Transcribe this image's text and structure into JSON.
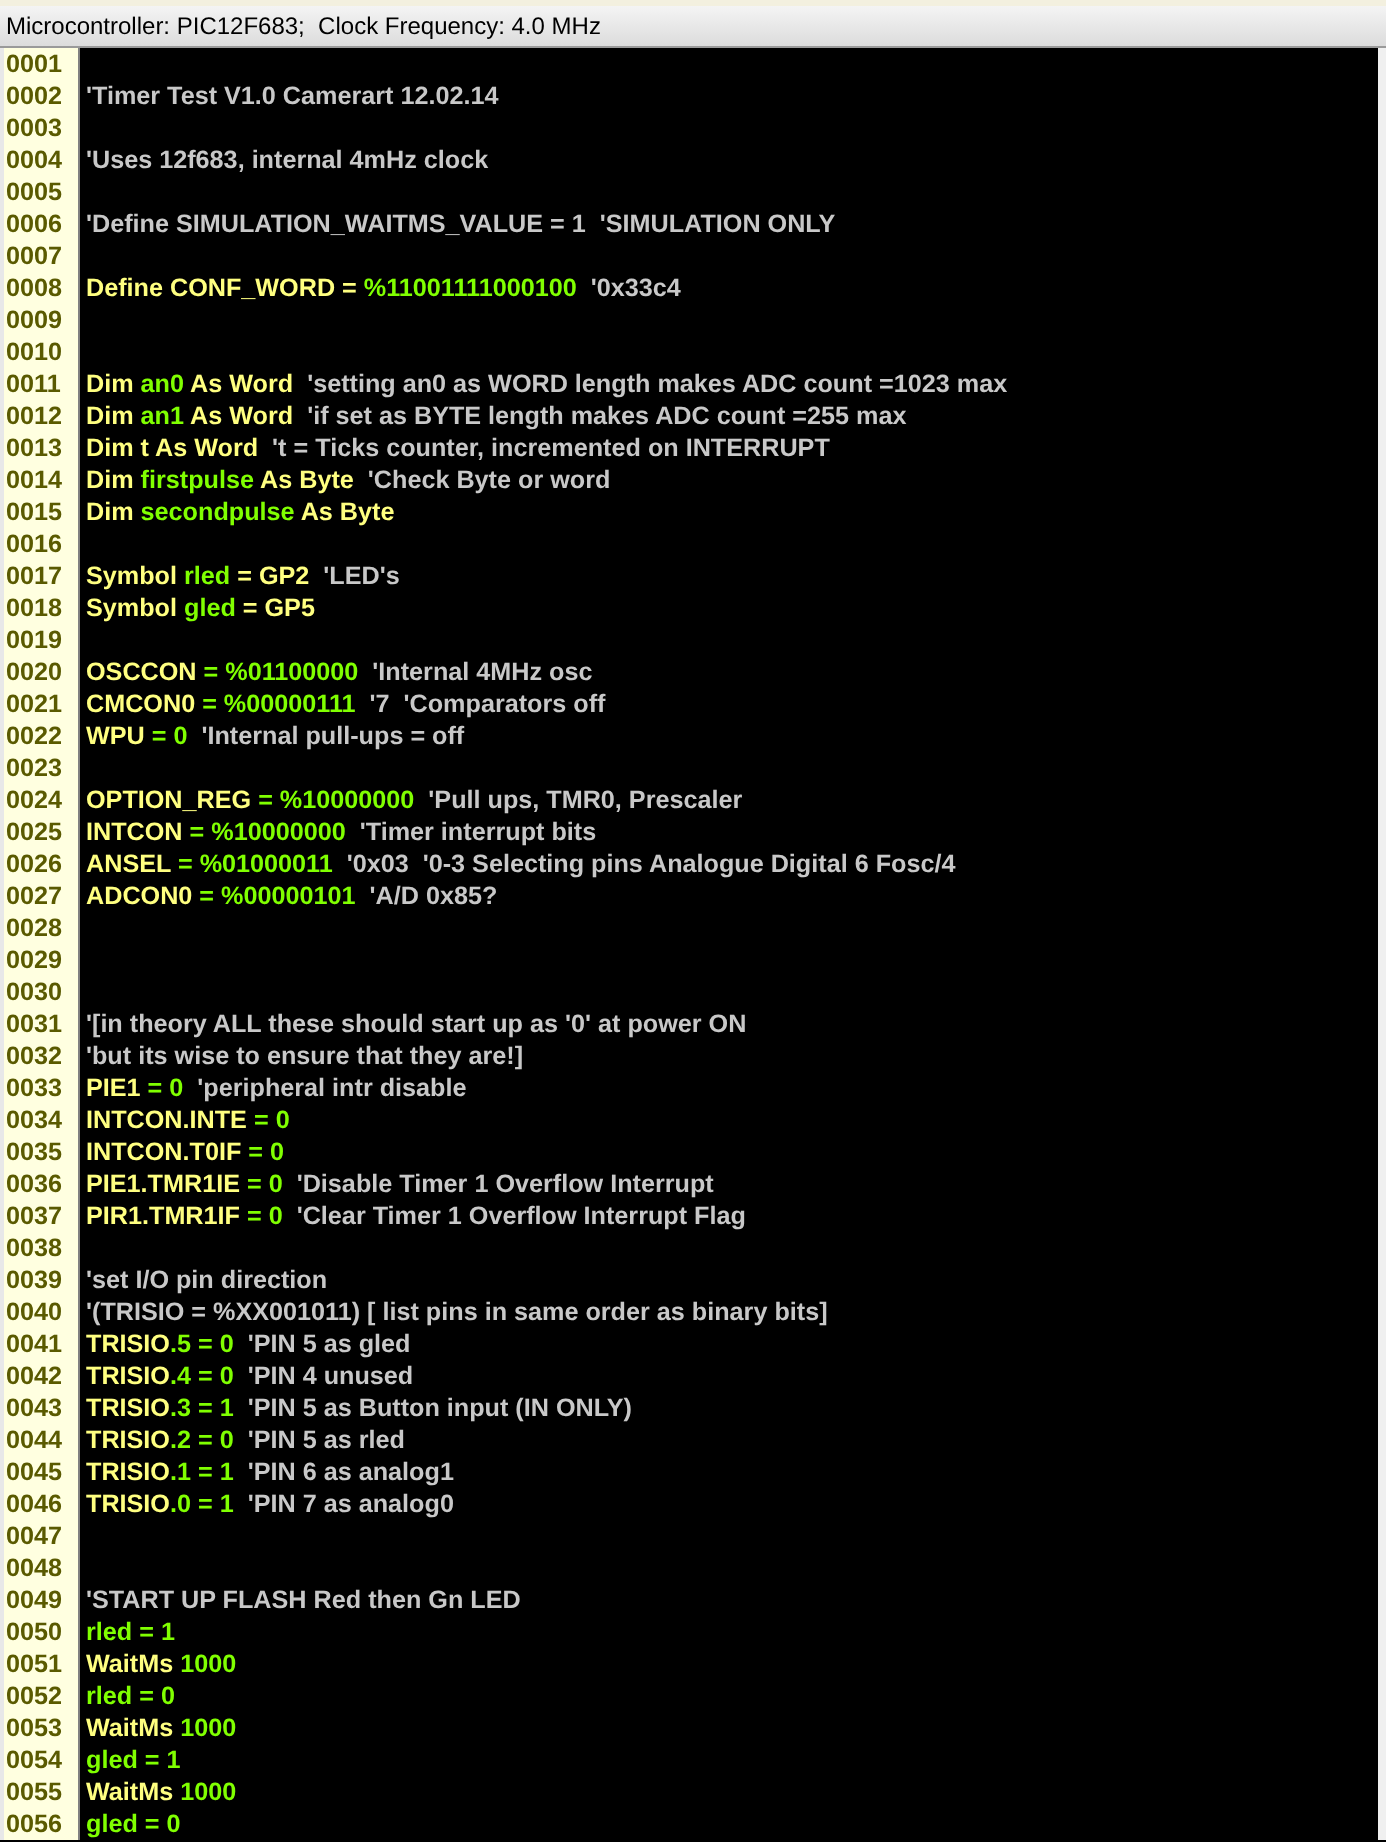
{
  "status_bar": {
    "text": "Microcontroller: PIC12F683;  Clock Frequency: 4.0 MHz"
  },
  "editor": {
    "lines": [
      {
        "number": "0001"
      },
      {
        "number": "0002",
        "tokens": [
          {
            "kind": "comment",
            "text": "'Timer Test V1.0 Camerart 12.02.14"
          }
        ]
      },
      {
        "number": "0003"
      },
      {
        "number": "0004",
        "tokens": [
          {
            "kind": "comment",
            "text": "'Uses 12f683, internal 4mHz clock"
          }
        ]
      },
      {
        "number": "0005"
      },
      {
        "number": "0006",
        "tokens": [
          {
            "kind": "comment",
            "text": "'Define SIMULATION_WAITMS_VALUE = 1  'SIMULATION ONLY"
          }
        ]
      },
      {
        "number": "0007"
      },
      {
        "number": "0008",
        "tokens": [
          {
            "kind": "keyword",
            "text": "Define CONF_WORD = "
          },
          {
            "kind": "name",
            "text": "%11001111000100"
          },
          {
            "kind": "comment",
            "text": "  '0x33c4"
          }
        ]
      },
      {
        "number": "0009"
      },
      {
        "number": "0010"
      },
      {
        "number": "0011",
        "tokens": [
          {
            "kind": "keyword",
            "text": "Dim "
          },
          {
            "kind": "name",
            "text": "an0"
          },
          {
            "kind": "keyword",
            "text": " As Word"
          },
          {
            "kind": "comment",
            "text": "  'setting an0 as WORD length makes ADC count =1023 max"
          }
        ]
      },
      {
        "number": "0012",
        "tokens": [
          {
            "kind": "keyword",
            "text": "Dim "
          },
          {
            "kind": "name",
            "text": "an1"
          },
          {
            "kind": "keyword",
            "text": " As Word"
          },
          {
            "kind": "comment",
            "text": "  'if set as BYTE length makes ADC count =255 max"
          }
        ]
      },
      {
        "number": "0013",
        "tokens": [
          {
            "kind": "keyword",
            "text": "Dim t As Word"
          },
          {
            "kind": "comment",
            "text": "  't = Ticks counter, incremented on INTERRUPT"
          }
        ]
      },
      {
        "number": "0014",
        "tokens": [
          {
            "kind": "keyword",
            "text": "Dim "
          },
          {
            "kind": "name",
            "text": "firstpulse"
          },
          {
            "kind": "keyword",
            "text": " As Byte"
          },
          {
            "kind": "comment",
            "text": "  'Check Byte or word"
          }
        ]
      },
      {
        "number": "0015",
        "tokens": [
          {
            "kind": "keyword",
            "text": "Dim "
          },
          {
            "kind": "name",
            "text": "secondpulse"
          },
          {
            "kind": "keyword",
            "text": " As Byte"
          }
        ]
      },
      {
        "number": "0016"
      },
      {
        "number": "0017",
        "tokens": [
          {
            "kind": "keyword",
            "text": "Symbol "
          },
          {
            "kind": "name",
            "text": "rled"
          },
          {
            "kind": "keyword",
            "text": " = GP2"
          },
          {
            "kind": "comment",
            "text": "  'LED's"
          }
        ]
      },
      {
        "number": "0018",
        "tokens": [
          {
            "kind": "keyword",
            "text": "Symbol "
          },
          {
            "kind": "name",
            "text": "gled"
          },
          {
            "kind": "keyword",
            "text": " = GP5"
          }
        ]
      },
      {
        "number": "0019"
      },
      {
        "number": "0020",
        "tokens": [
          {
            "kind": "keyword",
            "text": "OSCCON"
          },
          {
            "kind": "name",
            "text": " = %01100000"
          },
          {
            "kind": "comment",
            "text": "  'Internal 4MHz osc"
          }
        ]
      },
      {
        "number": "0021",
        "tokens": [
          {
            "kind": "keyword",
            "text": "CMCON0"
          },
          {
            "kind": "name",
            "text": " = %00000111"
          },
          {
            "kind": "comment",
            "text": "  '7  'Comparators off"
          }
        ]
      },
      {
        "number": "0022",
        "tokens": [
          {
            "kind": "keyword",
            "text": "WPU"
          },
          {
            "kind": "name",
            "text": " = 0"
          },
          {
            "kind": "comment",
            "text": "  'Internal pull-ups = off"
          }
        ]
      },
      {
        "number": "0023"
      },
      {
        "number": "0024",
        "tokens": [
          {
            "kind": "keyword",
            "text": "OPTION_REG"
          },
          {
            "kind": "name",
            "text": " = %10000000"
          },
          {
            "kind": "comment",
            "text": "  'Pull ups, TMR0, Prescaler"
          }
        ]
      },
      {
        "number": "0025",
        "tokens": [
          {
            "kind": "keyword",
            "text": "INTCON"
          },
          {
            "kind": "name",
            "text": " = %10000000"
          },
          {
            "kind": "comment",
            "text": "  'Timer interrupt bits"
          }
        ]
      },
      {
        "number": "0026",
        "tokens": [
          {
            "kind": "keyword",
            "text": "ANSEL"
          },
          {
            "kind": "name",
            "text": " = %01000011"
          },
          {
            "kind": "comment",
            "text": "  '0x03  '0-3 Selecting pins Analogue Digital 6 Fosc/4"
          }
        ]
      },
      {
        "number": "0027",
        "tokens": [
          {
            "kind": "keyword",
            "text": "ADCON0"
          },
          {
            "kind": "name",
            "text": " = %00000101"
          },
          {
            "kind": "comment",
            "text": "  'A/D 0x85?"
          }
        ]
      },
      {
        "number": "0028"
      },
      {
        "number": "0029"
      },
      {
        "number": "0030"
      },
      {
        "number": "0031",
        "tokens": [
          {
            "kind": "comment",
            "text": "'[in theory ALL these should start up as '0' at power ON"
          }
        ]
      },
      {
        "number": "0032",
        "tokens": [
          {
            "kind": "comment",
            "text": "'but its wise to ensure that they are!]"
          }
        ]
      },
      {
        "number": "0033",
        "tokens": [
          {
            "kind": "keyword",
            "text": "PIE1"
          },
          {
            "kind": "name",
            "text": " = 0"
          },
          {
            "kind": "comment",
            "text": "  'peripheral intr disable"
          }
        ]
      },
      {
        "number": "0034",
        "tokens": [
          {
            "kind": "keyword",
            "text": "INTCON.INTE"
          },
          {
            "kind": "name",
            "text": " = 0"
          }
        ]
      },
      {
        "number": "0035",
        "tokens": [
          {
            "kind": "keyword",
            "text": "INTCON.T0IF"
          },
          {
            "kind": "name",
            "text": " = 0"
          }
        ]
      },
      {
        "number": "0036",
        "tokens": [
          {
            "kind": "keyword",
            "text": "PIE1.TMR1IE"
          },
          {
            "kind": "name",
            "text": " = 0"
          },
          {
            "kind": "comment",
            "text": "  'Disable Timer 1 Overflow Interrupt"
          }
        ]
      },
      {
        "number": "0037",
        "tokens": [
          {
            "kind": "keyword",
            "text": "PIR1.TMR1IF"
          },
          {
            "kind": "name",
            "text": " = 0"
          },
          {
            "kind": "comment",
            "text": "  'Clear Timer 1 Overflow Interrupt Flag"
          }
        ]
      },
      {
        "number": "0038"
      },
      {
        "number": "0039",
        "tokens": [
          {
            "kind": "comment",
            "text": "'set I/O pin direction"
          }
        ]
      },
      {
        "number": "0040",
        "tokens": [
          {
            "kind": "comment",
            "text": "'(TRISIO = %XX001011) [ list pins in same order as binary bits]"
          }
        ]
      },
      {
        "number": "0041",
        "tokens": [
          {
            "kind": "keyword",
            "text": "TRISIO"
          },
          {
            "kind": "name",
            "text": ".5 = 0"
          },
          {
            "kind": "comment",
            "text": "  'PIN 5 as gled"
          }
        ]
      },
      {
        "number": "0042",
        "tokens": [
          {
            "kind": "keyword",
            "text": "TRISIO"
          },
          {
            "kind": "name",
            "text": ".4 = 0"
          },
          {
            "kind": "comment",
            "text": "  'PIN 4 unused"
          }
        ]
      },
      {
        "number": "0043",
        "tokens": [
          {
            "kind": "keyword",
            "text": "TRISIO"
          },
          {
            "kind": "name",
            "text": ".3 = 1"
          },
          {
            "kind": "comment",
            "text": "  'PIN 5 as Button input (IN ONLY)"
          }
        ]
      },
      {
        "number": "0044",
        "tokens": [
          {
            "kind": "keyword",
            "text": "TRISIO"
          },
          {
            "kind": "name",
            "text": ".2 = 0"
          },
          {
            "kind": "comment",
            "text": "  'PIN 5 as rled"
          }
        ]
      },
      {
        "number": "0045",
        "tokens": [
          {
            "kind": "keyword",
            "text": "TRISIO"
          },
          {
            "kind": "name",
            "text": ".1 = 1"
          },
          {
            "kind": "comment",
            "text": "  'PIN 6 as analog1"
          }
        ]
      },
      {
        "number": "0046",
        "tokens": [
          {
            "kind": "keyword",
            "text": "TRISIO"
          },
          {
            "kind": "name",
            "text": ".0 = 1"
          },
          {
            "kind": "comment",
            "text": "  'PIN 7 as analog0"
          }
        ]
      },
      {
        "number": "0047"
      },
      {
        "number": "0048"
      },
      {
        "number": "0049",
        "tokens": [
          {
            "kind": "comment",
            "text": "'START UP FLASH Red then Gn LED"
          }
        ]
      },
      {
        "number": "0050",
        "tokens": [
          {
            "kind": "name",
            "text": "rled = 1"
          }
        ]
      },
      {
        "number": "0051",
        "tokens": [
          {
            "kind": "keyword",
            "text": "WaitMs "
          },
          {
            "kind": "name",
            "text": "1000"
          }
        ]
      },
      {
        "number": "0052",
        "tokens": [
          {
            "kind": "name",
            "text": "rled = 0"
          }
        ]
      },
      {
        "number": "0053",
        "tokens": [
          {
            "kind": "keyword",
            "text": "WaitMs "
          },
          {
            "kind": "name",
            "text": "1000"
          }
        ]
      },
      {
        "number": "0054",
        "tokens": [
          {
            "kind": "name",
            "text": "gled = 1"
          }
        ]
      },
      {
        "number": "0055",
        "tokens": [
          {
            "kind": "keyword",
            "text": "WaitMs "
          },
          {
            "kind": "name",
            "text": "1000"
          }
        ]
      },
      {
        "number": "0056",
        "tokens": [
          {
            "kind": "name",
            "text": "gled = 0"
          }
        ]
      }
    ]
  }
}
